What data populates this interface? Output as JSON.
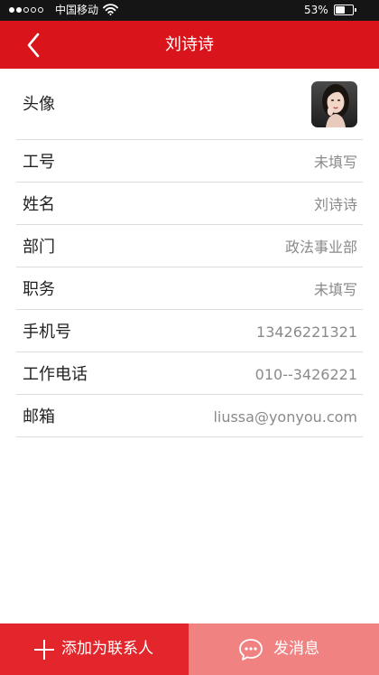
{
  "status_bar": {
    "carrier": "中国移动",
    "battery": "53%",
    "signal_icon": "signal-dots-icon",
    "wifi_icon": "wifi-icon",
    "battery_icon": "battery-icon",
    "battery_level": 0.53
  },
  "nav": {
    "title": "刘诗诗",
    "back_icon": "chevron-left-icon",
    "background": "#d9151b"
  },
  "profile": {
    "avatar_label": "头像",
    "fields": [
      {
        "label": "工号",
        "value": "未填写"
      },
      {
        "label": "姓名",
        "value": "刘诗诗"
      },
      {
        "label": "部门",
        "value": "政法事业部"
      },
      {
        "label": "职务",
        "value": "未填写"
      },
      {
        "label": "手机号",
        "value": "13426221321"
      },
      {
        "label": "工作电话",
        "value": "010--3426221"
      },
      {
        "label": "邮箱",
        "value": "liussa@yonyou.com"
      }
    ]
  },
  "actions": {
    "add_contact": "添加为联系人",
    "add_icon": "plus-icon",
    "add_color": "#e2262c",
    "send_message": "发消息",
    "send_icon": "chat-bubble-icon",
    "send_color": "#f08282"
  }
}
